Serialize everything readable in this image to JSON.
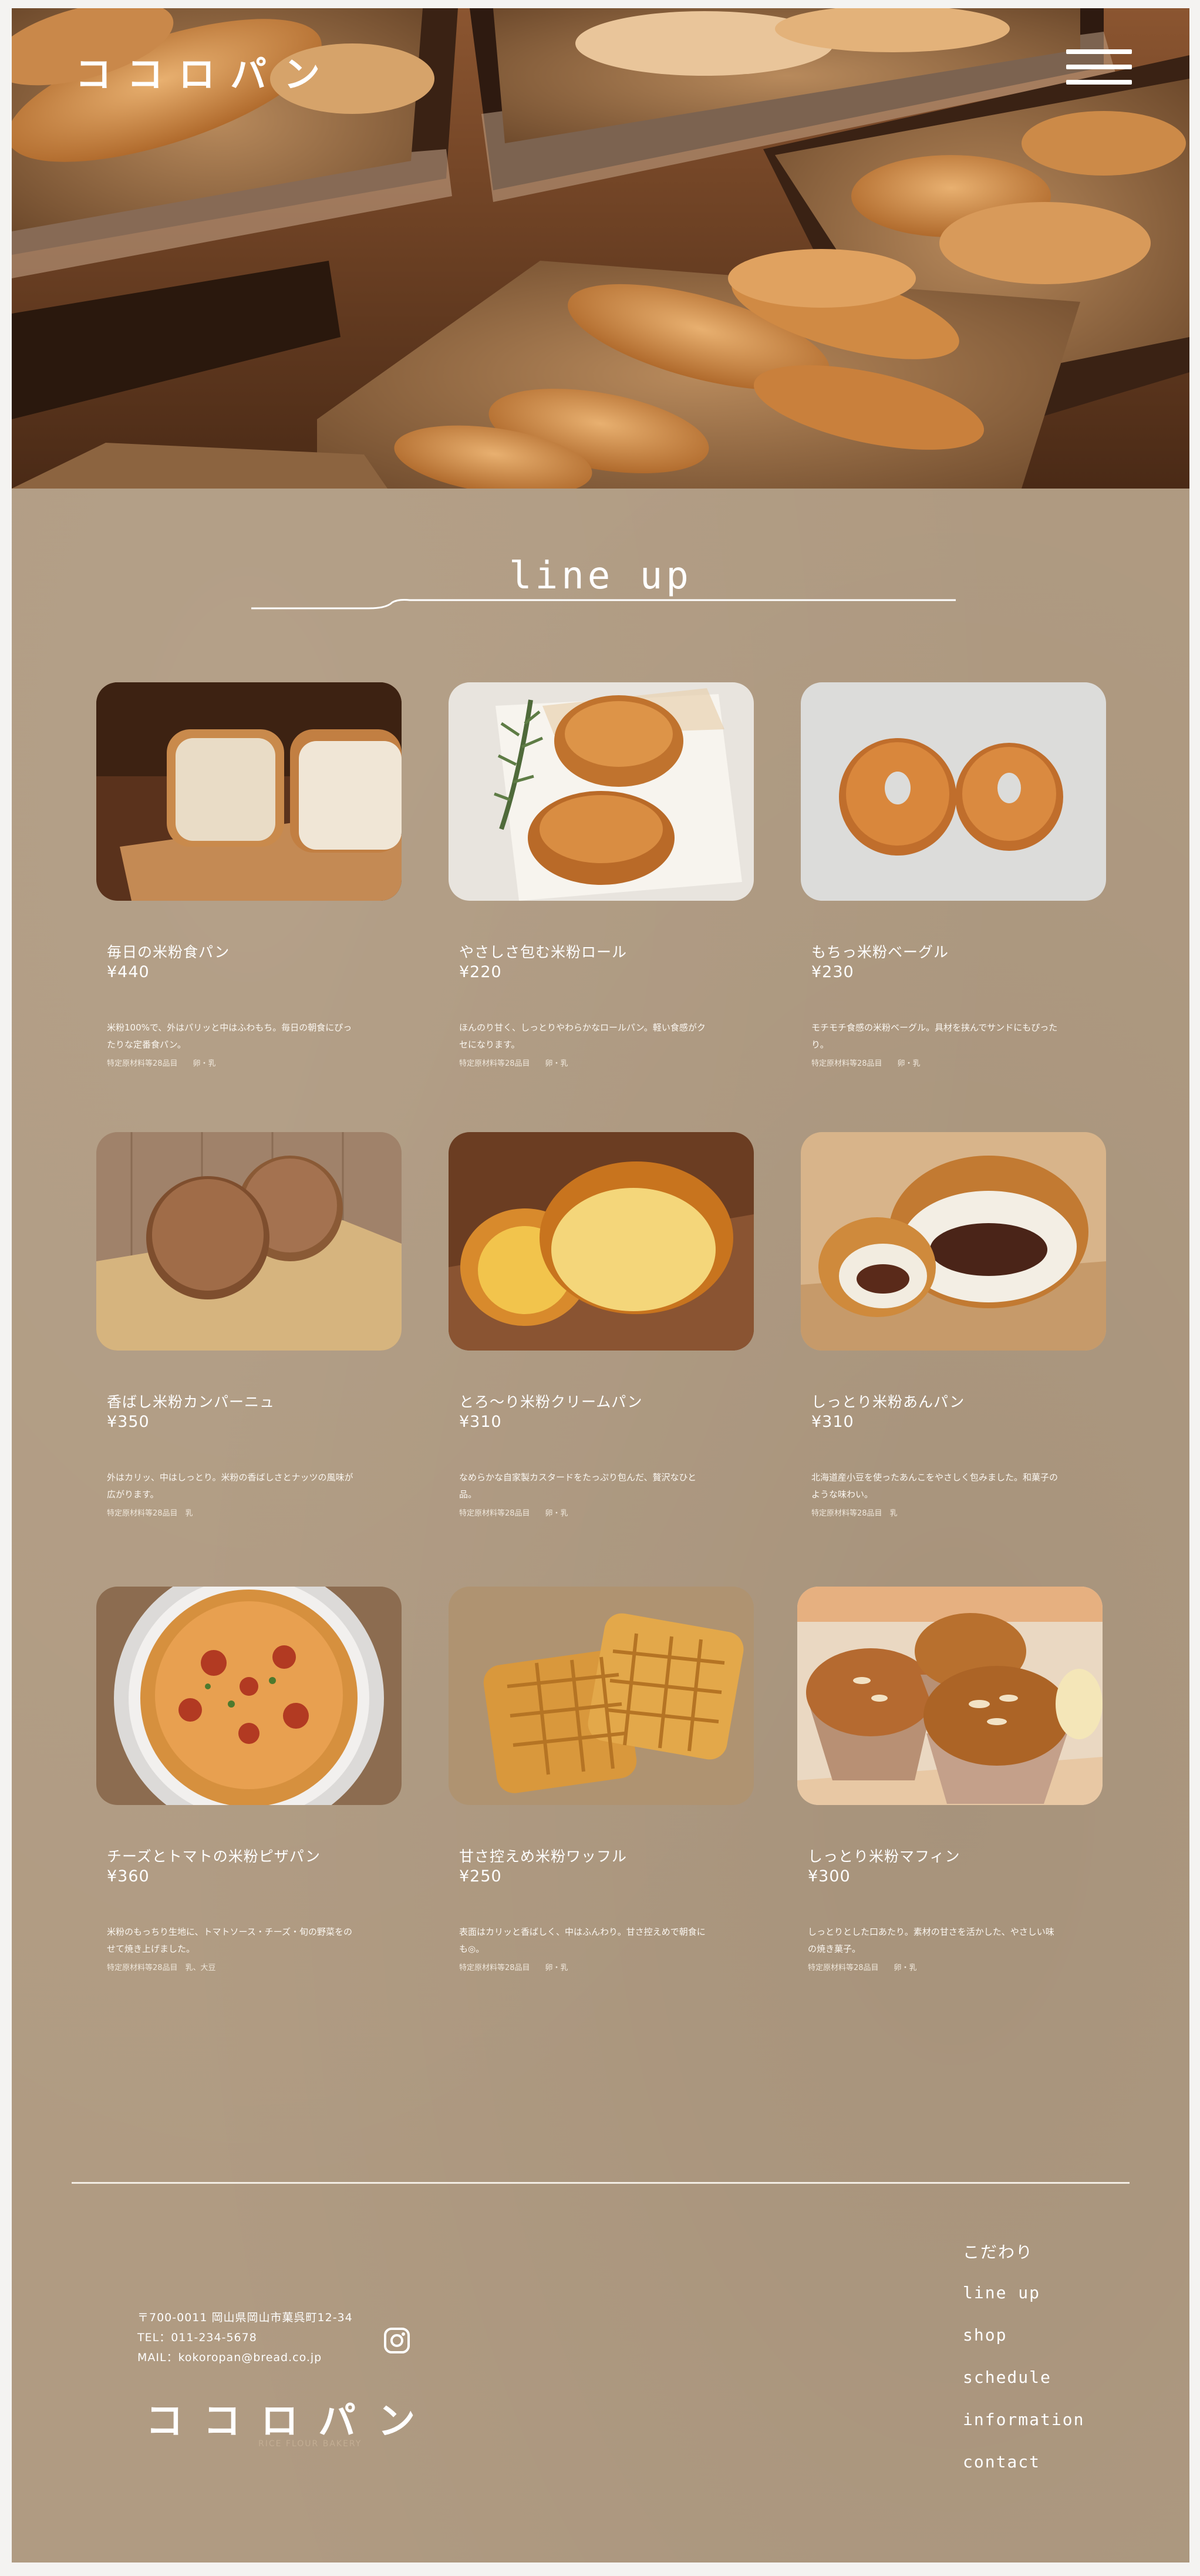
{
  "header": {
    "logo": "ココロパン"
  },
  "section": {
    "title": "line up"
  },
  "products": [
    {
      "name": "毎日の米粉食パン",
      "price": "¥440",
      "desc": "米粉100%で、外はパリッと中はふわもち。毎日の朝食にぴったりな定番食パン。",
      "allergen": "特定原材料等28品目　　卵・乳"
    },
    {
      "name": "やさしさ包む米粉ロール",
      "price": "¥220",
      "desc": "ほんのり甘く、しっとりやわらかなロールパン。軽い食感がクセになります。",
      "allergen": "特定原材料等28品目　　卵・乳"
    },
    {
      "name": "もちっ米粉ベーグル",
      "price": "¥230",
      "desc": "モチモチ食感の米粉ベーグル。具材を挟んでサンドにもぴったり。",
      "allergen": "特定原材料等28品目　　卵・乳"
    },
    {
      "name": "香ばし米粉カンパーニュ",
      "price": "¥350",
      "desc": "外はカリッ、中はしっとり。米粉の香ばしさとナッツの風味が広がります。",
      "allergen": "特定原材料等28品目　乳"
    },
    {
      "name": "とろ〜り米粉クリームパン",
      "price": "¥310",
      "desc": "なめらかな自家製カスタードをたっぷり包んだ、贅沢なひと品。",
      "allergen": "特定原材料等28品目　　卵・乳"
    },
    {
      "name": "しっとり米粉あんパン",
      "price": "¥310",
      "desc": "北海道産小豆を使ったあんこをやさしく包みました。和菓子のような味わい。",
      "allergen": "特定原材料等28品目　乳"
    },
    {
      "name": "チーズとトマトの米粉ピザパン",
      "price": "¥360",
      "desc": "米粉のもっちり生地に、トマトソース・チーズ・旬の野菜をのせて焼き上げました。",
      "allergen": "特定原材料等28品目　乳、大豆"
    },
    {
      "name": "甘さ控えめ米粉ワッフル",
      "price": "¥250",
      "desc": "表面はカリッと香ばしく、中はふんわり。甘さ控えめで朝食にも◎。",
      "allergen": "特定原材料等28品目　　卵・乳"
    },
    {
      "name": "しっとり米粉マフィン",
      "price": "¥300",
      "desc": "しっとりとした口あたり。素材の甘さを活かした、やさしい味の焼き菓子。",
      "allergen": "特定原材料等28品目　　卵・乳"
    }
  ],
  "footer": {
    "postal": "〒700-0011 岡山県岡山市菓呉町12-34",
    "tel": "TEL：011-234-5678",
    "mail": "MAIL：kokoropan@bread.co.jp",
    "logo": "ココロパン",
    "sub": "RICE FLOUR BAKERY",
    "nav": [
      "こだわり",
      "line up",
      "shop",
      "schedule",
      "information",
      "contact"
    ]
  }
}
